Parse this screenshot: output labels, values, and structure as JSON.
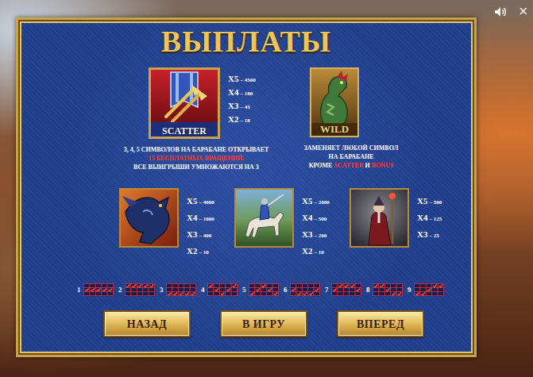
{
  "title": "ВЫПЛАТЫ",
  "close": "×",
  "special": [
    {
      "kind": "scatter",
      "label": "SCATTER",
      "pays": [
        {
          "mult": "X5",
          "pay": "– 4500"
        },
        {
          "mult": "X4",
          "pay": "– 180"
        },
        {
          "mult": "X3",
          "pay": "– 45"
        },
        {
          "mult": "X2",
          "pay": "– 18"
        }
      ],
      "desc": [
        [
          {
            "text": "3, 4, 5 СИМВОЛОВ НА БАРАБАНЕ ОТКРЫВАЕТ",
            "highlight": false
          }
        ],
        [
          {
            "text": "15 БЕСПЛАТНЫХ ВРАЩЕНИЙ.",
            "highlight": true
          }
        ],
        [
          {
            "text": "ВСЕ ВЫИГРЫШИ УМНОЖАЮТСЯ НА 3",
            "highlight": false
          }
        ]
      ]
    },
    {
      "kind": "wild",
      "label": "WILD",
      "pays": [],
      "desc": [
        [
          {
            "text": "ЗАМЕНЯЕТ ЛЮБОЙ СИМВОЛ",
            "highlight": false
          }
        ],
        [
          {
            "text": "НА БАРАБАНЕ",
            "highlight": false
          }
        ],
        [
          {
            "text": "КРОМЕ ",
            "highlight": false
          },
          {
            "text": "SCATTER",
            "highlight": true
          },
          {
            "text": " И ",
            "highlight": false
          },
          {
            "text": "BONUS",
            "highlight": true
          }
        ]
      ]
    }
  ],
  "symbols": [
    {
      "kind": "dragon",
      "pays": [
        {
          "mult": "X5",
          "pay": "– 4000"
        },
        {
          "mult": "X4",
          "pay": "– 1000"
        },
        {
          "mult": "X3",
          "pay": "– 400"
        },
        {
          "mult": "X2",
          "pay": "– 10"
        }
      ]
    },
    {
      "kind": "knight",
      "pays": [
        {
          "mult": "X5",
          "pay": "– 2000"
        },
        {
          "mult": "X4",
          "pay": "– 500"
        },
        {
          "mult": "X3",
          "pay": "– 200"
        },
        {
          "mult": "X2",
          "pay": "– 10"
        }
      ]
    },
    {
      "kind": "mage",
      "pays": [
        {
          "mult": "X5",
          "pay": "– 500"
        },
        {
          "mult": "X4",
          "pay": "– 125"
        },
        {
          "mult": "X3",
          "pay": "– 25"
        }
      ]
    }
  ],
  "paylines": [
    {
      "number": "1",
      "rows": [
        1,
        1,
        1,
        1,
        1
      ]
    },
    {
      "number": "2",
      "rows": [
        0,
        0,
        0,
        0,
        0
      ]
    },
    {
      "number": "3",
      "rows": [
        2,
        2,
        2,
        2,
        2
      ]
    },
    {
      "number": "4",
      "rows": [
        0,
        1,
        2,
        1,
        0
      ]
    },
    {
      "number": "5",
      "rows": [
        2,
        1,
        0,
        1,
        2
      ]
    },
    {
      "number": "6",
      "rows": [
        1,
        2,
        2,
        2,
        1
      ]
    },
    {
      "number": "7",
      "rows": [
        1,
        0,
        0,
        0,
        1
      ]
    },
    {
      "number": "8",
      "rows": [
        0,
        0,
        1,
        2,
        2
      ]
    },
    {
      "number": "9",
      "rows": [
        2,
        2,
        1,
        0,
        0
      ]
    }
  ],
  "buttons": [
    "НАЗАД",
    "В ИГРУ",
    "ВПЕРЕД"
  ]
}
